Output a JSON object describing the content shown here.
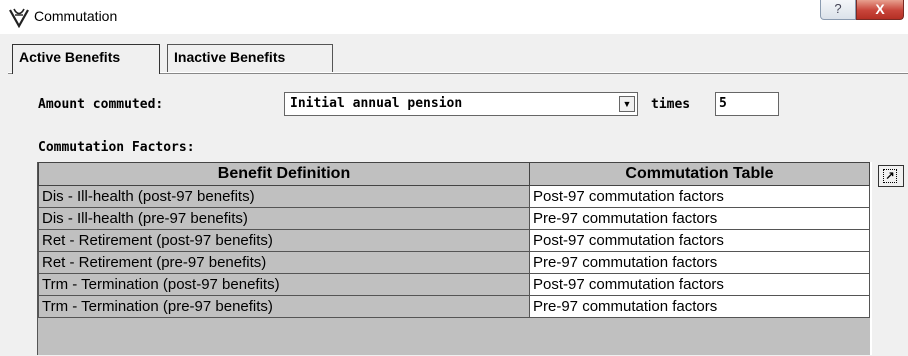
{
  "window": {
    "title": "Commutation",
    "help_label": "?",
    "close_label": "X"
  },
  "tabs": [
    {
      "label": "Active Benefits",
      "selected": true
    },
    {
      "label": "Inactive Benefits",
      "selected": false
    }
  ],
  "amount": {
    "label": "Amount commuted:",
    "selected": "Initial annual pension",
    "times_label": "times",
    "times_value": "5"
  },
  "factors": {
    "label": "Commutation Factors:",
    "columns": [
      "Benefit Definition",
      "Commutation Table"
    ],
    "rows": [
      [
        "Dis - Ill-health (post-97 benefits)",
        "Post-97 commutation factors"
      ],
      [
        "Dis - Ill-health (pre-97 benefits)",
        "Pre-97 commutation factors"
      ],
      [
        "Ret - Retirement (post-97 benefits)",
        "Post-97 commutation factors"
      ],
      [
        "Ret - Retirement (pre-97 benefits)",
        "Pre-97 commutation factors"
      ],
      [
        "Trm - Termination (post-97 benefits)",
        "Post-97 commutation factors"
      ],
      [
        "Trm - Termination (pre-97 benefits)",
        "Pre-97 commutation factors"
      ]
    ]
  },
  "colors": {
    "close": "#c8453a",
    "grid": "#c0c0c0"
  }
}
